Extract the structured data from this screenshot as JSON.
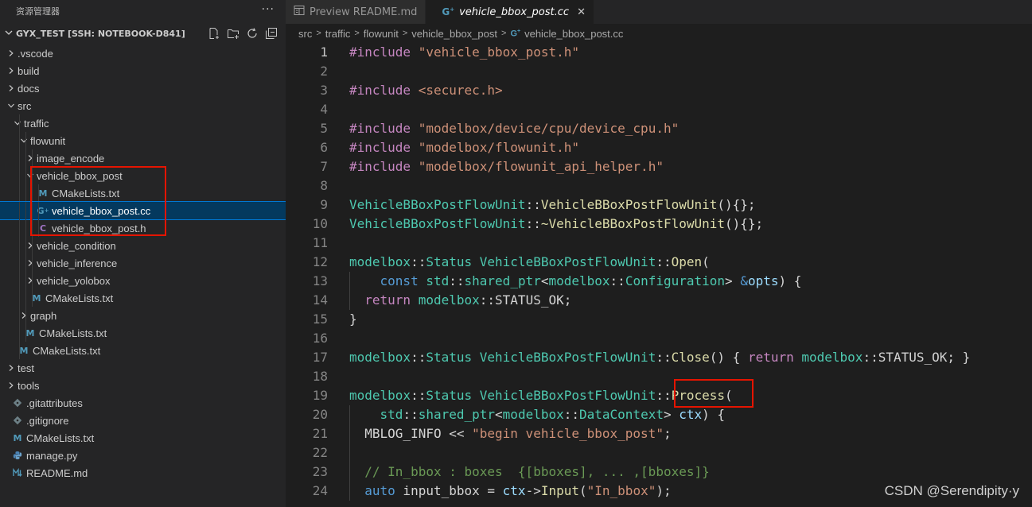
{
  "sidebar": {
    "title": "资源管理器",
    "more": "···",
    "workspace": "GYX_TEST [SSH: NOTEBOOK-D841]",
    "tree": [
      {
        "label": ".vscode",
        "depth": 0,
        "kind": "folder",
        "open": false
      },
      {
        "label": "build",
        "depth": 0,
        "kind": "folder",
        "open": false
      },
      {
        "label": "docs",
        "depth": 0,
        "kind": "folder",
        "open": false
      },
      {
        "label": "src",
        "depth": 0,
        "kind": "folder",
        "open": true
      },
      {
        "label": "traffic",
        "depth": 1,
        "kind": "folder",
        "open": true
      },
      {
        "label": "flowunit",
        "depth": 2,
        "kind": "folder",
        "open": true
      },
      {
        "label": "image_encode",
        "depth": 3,
        "kind": "folder",
        "open": false
      },
      {
        "label": "vehicle_bbox_post",
        "depth": 3,
        "kind": "folder",
        "open": true
      },
      {
        "label": "CMakeLists.txt",
        "depth": 4,
        "kind": "cmake"
      },
      {
        "label": "vehicle_bbox_post.cc",
        "depth": 4,
        "kind": "cpp",
        "selected": true
      },
      {
        "label": "vehicle_bbox_post.h",
        "depth": 4,
        "kind": "header"
      },
      {
        "label": "vehicle_condition",
        "depth": 3,
        "kind": "folder",
        "open": false
      },
      {
        "label": "vehicle_inference",
        "depth": 3,
        "kind": "folder",
        "open": false
      },
      {
        "label": "vehicle_yolobox",
        "depth": 3,
        "kind": "folder",
        "open": false
      },
      {
        "label": "CMakeLists.txt",
        "depth": 3,
        "kind": "cmake"
      },
      {
        "label": "graph",
        "depth": 2,
        "kind": "folder",
        "open": false
      },
      {
        "label": "CMakeLists.txt",
        "depth": 2,
        "kind": "cmake"
      },
      {
        "label": "CMakeLists.txt",
        "depth": 1,
        "kind": "cmake"
      },
      {
        "label": "test",
        "depth": 0,
        "kind": "folder",
        "open": false
      },
      {
        "label": "tools",
        "depth": 0,
        "kind": "folder",
        "open": false
      },
      {
        "label": ".gitattributes",
        "depth": 0,
        "kind": "git"
      },
      {
        "label": ".gitignore",
        "depth": 0,
        "kind": "git"
      },
      {
        "label": "CMakeLists.txt",
        "depth": 0,
        "kind": "cmake"
      },
      {
        "label": "manage.py",
        "depth": 0,
        "kind": "python"
      },
      {
        "label": "README.md",
        "depth": 0,
        "kind": "markdown"
      }
    ]
  },
  "icons": {
    "cmake": "M",
    "cpp": "G",
    "header": "C"
  },
  "tabs": [
    {
      "label": "Preview README.md",
      "icon": "preview-icon",
      "active": false
    },
    {
      "label": "vehicle_bbox_post.cc",
      "icon": "cpp-file-icon",
      "active": true,
      "close": "✕"
    }
  ],
  "breadcrumb": [
    "src",
    "traffic",
    "flowunit",
    "vehicle_bbox_post",
    "vehicle_bbox_post.cc"
  ],
  "editor": {
    "lines": [
      {
        "n": "1",
        "tokens": [
          [
            "kw",
            "#include "
          ],
          [
            "str",
            "\"vehicle_bbox_post.h\""
          ]
        ]
      },
      {
        "n": "2",
        "tokens": []
      },
      {
        "n": "3",
        "tokens": [
          [
            "kw",
            "#include "
          ],
          [
            "str",
            "<securec.h>"
          ]
        ]
      },
      {
        "n": "4",
        "tokens": []
      },
      {
        "n": "5",
        "tokens": [
          [
            "kw",
            "#include "
          ],
          [
            "str",
            "\"modelbox/device/cpu/device_cpu.h\""
          ]
        ]
      },
      {
        "n": "6",
        "tokens": [
          [
            "kw",
            "#include "
          ],
          [
            "str",
            "\"modelbox/flowunit.h\""
          ]
        ]
      },
      {
        "n": "7",
        "tokens": [
          [
            "kw",
            "#include "
          ],
          [
            "str",
            "\"modelbox/flowunit_api_helper.h\""
          ]
        ]
      },
      {
        "n": "8",
        "tokens": []
      },
      {
        "n": "9",
        "tokens": [
          [
            "type",
            "VehicleBBoxPostFlowUnit"
          ],
          [
            "plain",
            "::"
          ],
          [
            "fn",
            "VehicleBBoxPostFlowUnit"
          ],
          [
            "plain",
            "(){};"
          ]
        ]
      },
      {
        "n": "10",
        "tokens": [
          [
            "type",
            "VehicleBBoxPostFlowUnit"
          ],
          [
            "plain",
            "::"
          ],
          [
            "fn",
            "~VehicleBBoxPostFlowUnit"
          ],
          [
            "plain",
            "(){};"
          ]
        ]
      },
      {
        "n": "11",
        "tokens": []
      },
      {
        "n": "12",
        "tokens": [
          [
            "type",
            "modelbox"
          ],
          [
            "plain",
            "::"
          ],
          [
            "type",
            "Status"
          ],
          [
            "plain",
            " "
          ],
          [
            "type",
            "VehicleBBoxPostFlowUnit"
          ],
          [
            "plain",
            "::"
          ],
          [
            "fn",
            "Open"
          ],
          [
            "plain",
            "("
          ]
        ]
      },
      {
        "n": "13",
        "tokens": [
          [
            "plain",
            "    "
          ],
          [
            "blue",
            "const"
          ],
          [
            "plain",
            " "
          ],
          [
            "type",
            "std"
          ],
          [
            "plain",
            "::"
          ],
          [
            "type",
            "shared_ptr"
          ],
          [
            "plain",
            "<"
          ],
          [
            "type",
            "modelbox"
          ],
          [
            "plain",
            "::"
          ],
          [
            "type",
            "Configuration"
          ],
          [
            "plain",
            "> "
          ],
          [
            "blue",
            "&"
          ],
          [
            "var",
            "opts"
          ],
          [
            "plain",
            ") {"
          ]
        ]
      },
      {
        "n": "14",
        "tokens": [
          [
            "plain",
            "  "
          ],
          [
            "kw",
            "return"
          ],
          [
            "plain",
            " "
          ],
          [
            "type",
            "modelbox"
          ],
          [
            "plain",
            "::STATUS_OK;"
          ]
        ]
      },
      {
        "n": "15",
        "tokens": [
          [
            "plain",
            "}"
          ]
        ]
      },
      {
        "n": "16",
        "tokens": []
      },
      {
        "n": "17",
        "tokens": [
          [
            "type",
            "modelbox"
          ],
          [
            "plain",
            "::"
          ],
          [
            "type",
            "Status"
          ],
          [
            "plain",
            " "
          ],
          [
            "type",
            "VehicleBBoxPostFlowUnit"
          ],
          [
            "plain",
            "::"
          ],
          [
            "fn",
            "Close"
          ],
          [
            "plain",
            "() { "
          ],
          [
            "kw",
            "return"
          ],
          [
            "plain",
            " "
          ],
          [
            "type",
            "modelbox"
          ],
          [
            "plain",
            "::STATUS_OK; }"
          ]
        ]
      },
      {
        "n": "18",
        "tokens": []
      },
      {
        "n": "19",
        "tokens": [
          [
            "type",
            "modelbox"
          ],
          [
            "plain",
            "::"
          ],
          [
            "type",
            "Status"
          ],
          [
            "plain",
            " "
          ],
          [
            "type",
            "VehicleBBoxPostFlowUnit"
          ],
          [
            "plain",
            "::"
          ],
          [
            "fn",
            "Process"
          ],
          [
            "plain",
            "("
          ]
        ]
      },
      {
        "n": "20",
        "tokens": [
          [
            "plain",
            "    "
          ],
          [
            "type",
            "std"
          ],
          [
            "plain",
            "::"
          ],
          [
            "type",
            "shared_ptr"
          ],
          [
            "plain",
            "<"
          ],
          [
            "type",
            "modelbox"
          ],
          [
            "plain",
            "::"
          ],
          [
            "type",
            "DataContext"
          ],
          [
            "plain",
            "> "
          ],
          [
            "var",
            "ctx"
          ],
          [
            "plain",
            ") {"
          ]
        ]
      },
      {
        "n": "21",
        "tokens": [
          [
            "plain",
            "  MBLOG_INFO << "
          ],
          [
            "str",
            "\"begin vehicle_bbox_post\""
          ],
          [
            "plain",
            ";"
          ]
        ]
      },
      {
        "n": "22",
        "tokens": []
      },
      {
        "n": "23",
        "tokens": [
          [
            "plain",
            "  "
          ],
          [
            "cm",
            "// In_bbox : boxes  {[bboxes], ... ,[bboxes]}"
          ]
        ]
      },
      {
        "n": "24",
        "tokens": [
          [
            "plain",
            "  "
          ],
          [
            "blue",
            "auto"
          ],
          [
            "plain",
            " input_bbox = "
          ],
          [
            "var",
            "ctx"
          ],
          [
            "plain",
            "->"
          ],
          [
            "fn",
            "Input"
          ],
          [
            "plain",
            "("
          ],
          [
            "str",
            "\"In_bbox\""
          ],
          [
            "plain",
            ");"
          ]
        ]
      }
    ]
  },
  "watermark": "CSDN @Serendipity·y",
  "colors": {
    "highlight_box": "#e51400",
    "selection": "#04395e"
  }
}
